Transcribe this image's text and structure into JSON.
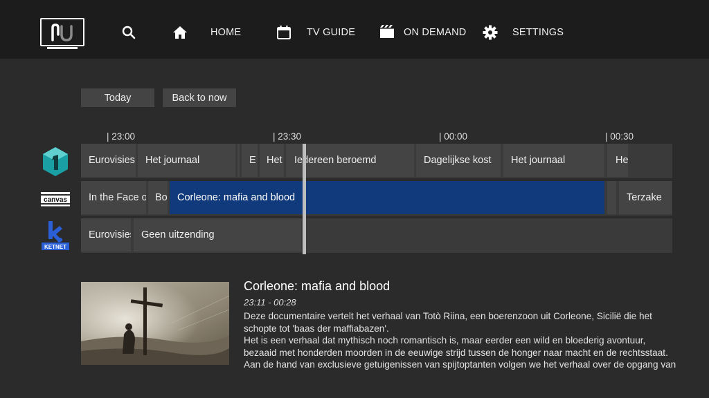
{
  "nav": {
    "home_label": "HOME",
    "tvguide_label": "TV GUIDE",
    "ondemand_label": "ON DEMAND",
    "settings_label": "SETTINGS",
    "icons": [
      "logo-icon",
      "search-icon",
      "home-icon",
      "calendar-icon",
      "film-icon",
      "gear-icon"
    ]
  },
  "controls": {
    "today_label": "Today",
    "back_to_now_label": "Back to now"
  },
  "timeline": {
    "labels": [
      "| 23:00",
      "| 23:30",
      "| 00:00",
      "| 00:30"
    ]
  },
  "channels": [
    {
      "name": "één",
      "logo_icon": "een-logo-icon",
      "programs": [
        "Eurovisies",
        "Het journaal",
        "E",
        "Het",
        "Iedereen beroemd",
        "Dagelijkse kost",
        "Het journaal",
        "He"
      ]
    },
    {
      "name": "canvas",
      "logo_text": "canvas",
      "logo_icon": "canvas-logo-icon",
      "programs": [
        "In the Face of",
        "Bo",
        "Corleone: mafia and blood",
        "",
        "Terzake"
      ]
    },
    {
      "name": "Ketnet",
      "logo_text": "KETNET",
      "logo_icon": "ketnet-logo-icon",
      "programs": [
        "Eurovisies",
        "Geen uitzending"
      ]
    }
  ],
  "detail": {
    "title": "Corleone: mafia and blood",
    "time": "23:11 - 00:28",
    "description": [
      "Deze documentaire vertelt het verhaal van Totò Riina, een boerenzoon uit Corleone, Sicilië die het schopte tot 'baas der maffiabazen'.",
      "Het is een verhaal dat mythisch noch romantisch is, maar eerder een wild en bloederig avontuur, bezaaid met honderden moorden in de eeuwige strijd tussen de honger naar macht en de rechtsstaat.",
      "Aan de hand van exclusieve getuigenissen van spijtoptanten volgen we het verhaal over de opgang van"
    ]
  },
  "colors": {
    "background": "#2b2b2b",
    "topbar": "#1c1c1c",
    "program_tile": "#444444",
    "selected_program": "#103a7c",
    "een_teal": "#1aa0a4",
    "ketnet_blue": "#2a5fd6"
  }
}
